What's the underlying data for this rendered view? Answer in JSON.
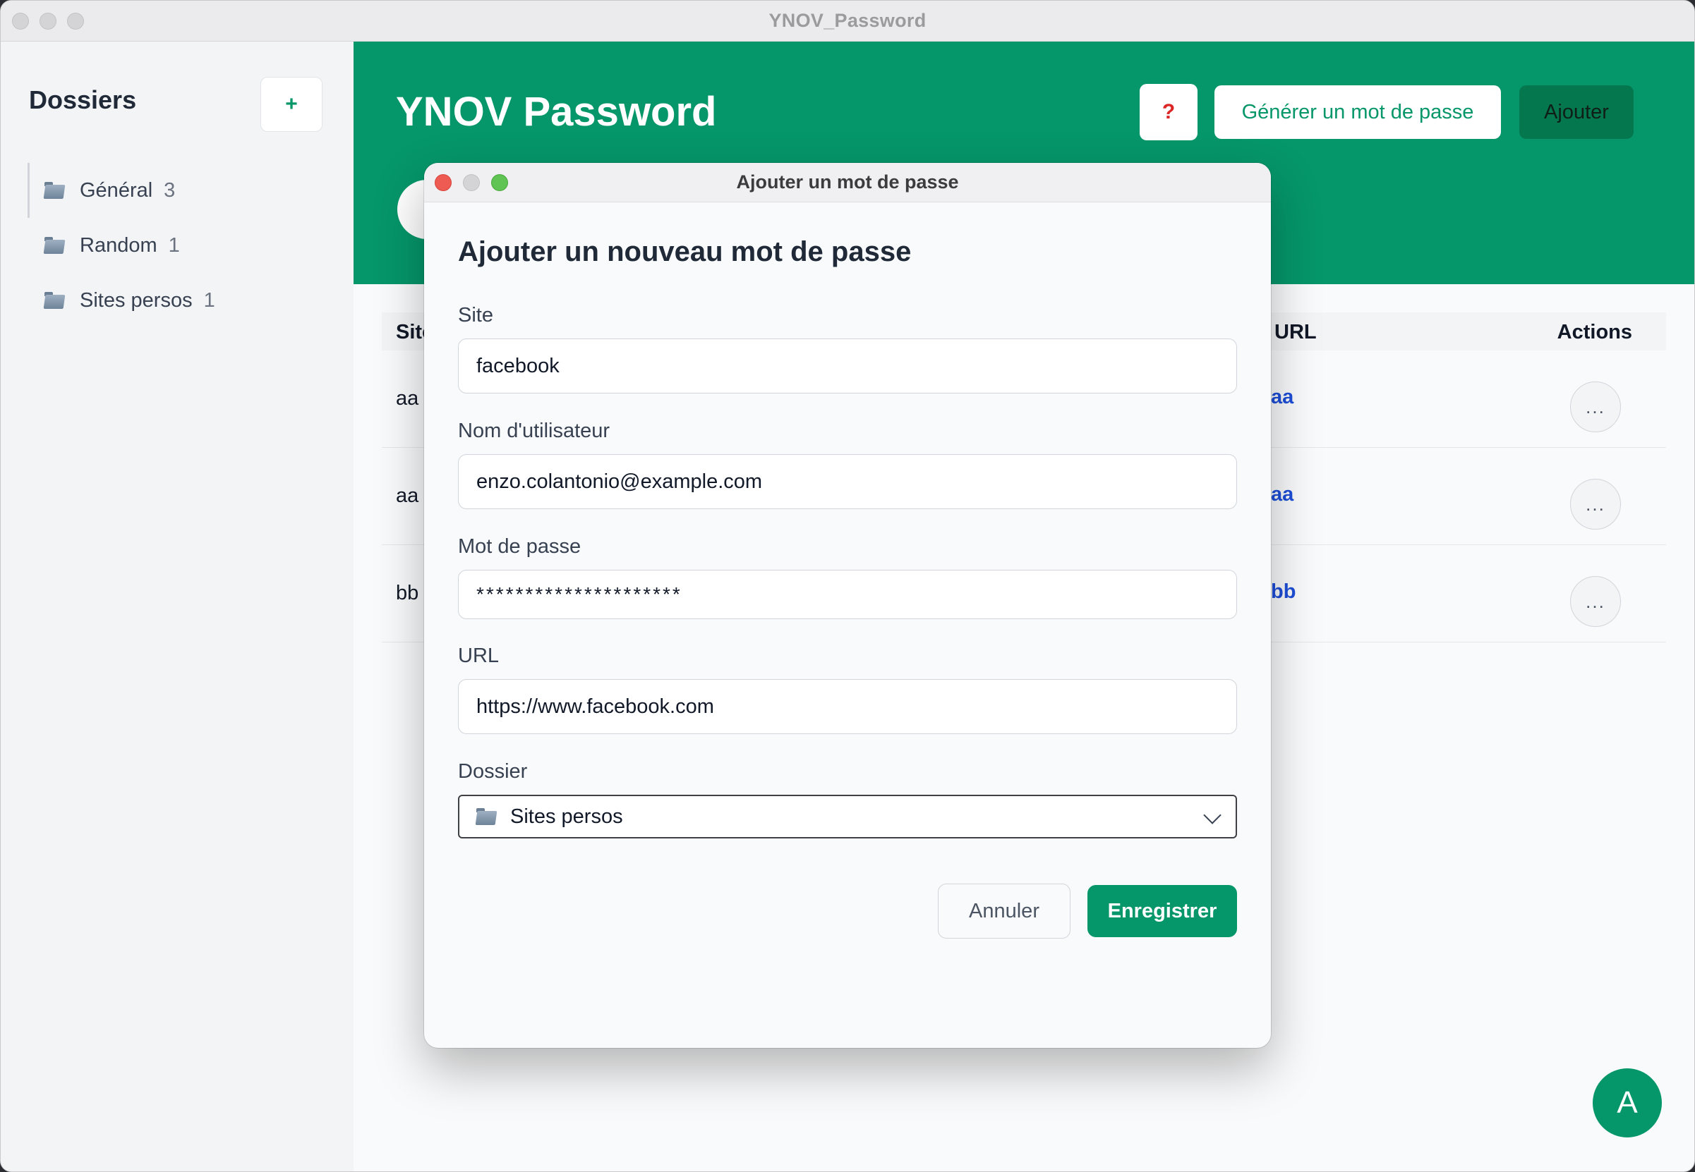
{
  "window": {
    "title": "YNOV_Password"
  },
  "sidebar": {
    "title": "Dossiers",
    "add_label": "+",
    "items": [
      {
        "label": "Général",
        "count": "3"
      },
      {
        "label": "Random",
        "count": "1"
      },
      {
        "label": "Sites persos",
        "count": "1"
      }
    ]
  },
  "header": {
    "title": "YNOV Password",
    "help_label": "?",
    "generate_label": "Générer un mot de passe",
    "add_label": "Ajouter"
  },
  "table": {
    "columns": {
      "site": "Site",
      "url": "URL",
      "actions": "Actions"
    },
    "rows": [
      {
        "site": "aa",
        "url": "aa",
        "menu": "..."
      },
      {
        "site": "aa",
        "url": "aa",
        "menu": "..."
      },
      {
        "site": "bb",
        "url": "bb",
        "menu": "..."
      }
    ]
  },
  "avatar": {
    "initial": "A"
  },
  "dialog": {
    "window_title": "Ajouter un mot de passe",
    "heading": "Ajouter un nouveau mot de passe",
    "site": {
      "label": "Site",
      "value": "facebook"
    },
    "username": {
      "label": "Nom d'utilisateur",
      "value": "enzo.colantonio@example.com"
    },
    "password": {
      "label": "Mot de passe",
      "value": "*********************"
    },
    "url": {
      "label": "URL",
      "value": "https://www.facebook.com"
    },
    "folder": {
      "label": "Dossier",
      "selected": "Sites persos"
    },
    "cancel_label": "Annuler",
    "save_label": "Enregistrer"
  },
  "colors": {
    "brand": "#059669",
    "brand_dark": "#04774f",
    "link": "#1d4ed8",
    "danger": "#dc2626"
  },
  "icons": [
    "folder-icon",
    "plus-icon",
    "question-icon",
    "more-icon",
    "chevron-down-icon"
  ]
}
